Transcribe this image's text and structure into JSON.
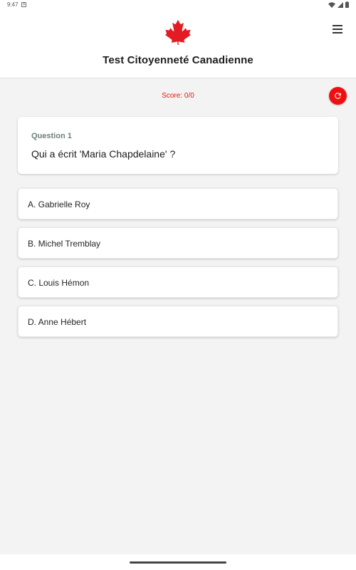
{
  "status_bar": {
    "time": "9:47",
    "notification_icon": "a"
  },
  "header": {
    "logo_icon": "maple-leaf",
    "title": "Test Citoyenneté Canadienne",
    "menu_icon": "hamburger-menu"
  },
  "score": {
    "label": "Score: 0/0",
    "color": "#e8160c"
  },
  "refresh": {
    "icon": "refresh"
  },
  "question": {
    "number_label": "Question 1",
    "text": "Qui a écrit 'Maria Chapdelaine' ?"
  },
  "answers": [
    {
      "label": "A. Gabrielle Roy"
    },
    {
      "label": "B. Michel Tremblay"
    },
    {
      "label": "C. Louis Hémon"
    },
    {
      "label": "D. Anne Hébert"
    }
  ],
  "colors": {
    "accent": "#ee1010",
    "background": "#f3f3f3"
  }
}
